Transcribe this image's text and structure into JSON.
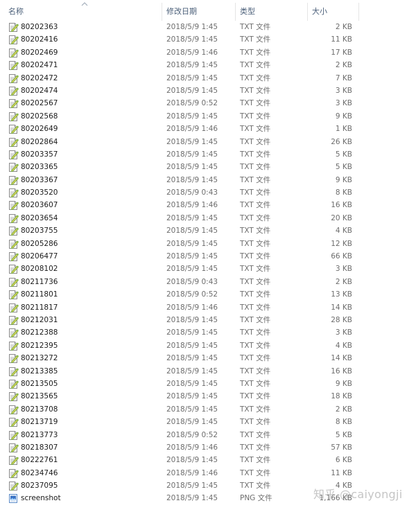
{
  "columns": {
    "name": "名称",
    "date": "修改日期",
    "type": "类型",
    "size": "大小"
  },
  "colors": {
    "header_text": "#4c607a",
    "meta_text": "#6d6d6d",
    "txt_icon_accent": "#7bb343"
  },
  "files": [
    {
      "name": "80202363",
      "date": "2018/5/9 1:45",
      "type": "TXT 文件",
      "size": "2 KB",
      "icon": "txt-file-icon"
    },
    {
      "name": "80202416",
      "date": "2018/5/9 1:45",
      "type": "TXT 文件",
      "size": "11 KB",
      "icon": "txt-file-icon"
    },
    {
      "name": "80202469",
      "date": "2018/5/9 1:46",
      "type": "TXT 文件",
      "size": "17 KB",
      "icon": "txt-file-icon"
    },
    {
      "name": "80202471",
      "date": "2018/5/9 1:45",
      "type": "TXT 文件",
      "size": "2 KB",
      "icon": "txt-file-icon"
    },
    {
      "name": "80202472",
      "date": "2018/5/9 1:45",
      "type": "TXT 文件",
      "size": "7 KB",
      "icon": "txt-file-icon"
    },
    {
      "name": "80202474",
      "date": "2018/5/9 1:45",
      "type": "TXT 文件",
      "size": "3 KB",
      "icon": "txt-file-icon"
    },
    {
      "name": "80202567",
      "date": "2018/5/9 0:52",
      "type": "TXT 文件",
      "size": "3 KB",
      "icon": "txt-file-icon"
    },
    {
      "name": "80202568",
      "date": "2018/5/9 1:45",
      "type": "TXT 文件",
      "size": "9 KB",
      "icon": "txt-file-icon"
    },
    {
      "name": "80202649",
      "date": "2018/5/9 1:46",
      "type": "TXT 文件",
      "size": "1 KB",
      "icon": "txt-file-icon"
    },
    {
      "name": "80202864",
      "date": "2018/5/9 1:45",
      "type": "TXT 文件",
      "size": "26 KB",
      "icon": "txt-file-icon"
    },
    {
      "name": "80203357",
      "date": "2018/5/9 1:45",
      "type": "TXT 文件",
      "size": "5 KB",
      "icon": "txt-file-icon"
    },
    {
      "name": "80203365",
      "date": "2018/5/9 1:45",
      "type": "TXT 文件",
      "size": "5 KB",
      "icon": "txt-file-icon"
    },
    {
      "name": "80203367",
      "date": "2018/5/9 1:45",
      "type": "TXT 文件",
      "size": "9 KB",
      "icon": "txt-file-icon"
    },
    {
      "name": "80203520",
      "date": "2018/5/9 0:43",
      "type": "TXT 文件",
      "size": "8 KB",
      "icon": "txt-file-icon"
    },
    {
      "name": "80203607",
      "date": "2018/5/9 1:46",
      "type": "TXT 文件",
      "size": "16 KB",
      "icon": "txt-file-icon"
    },
    {
      "name": "80203654",
      "date": "2018/5/9 1:45",
      "type": "TXT 文件",
      "size": "20 KB",
      "icon": "txt-file-icon"
    },
    {
      "name": "80203755",
      "date": "2018/5/9 1:45",
      "type": "TXT 文件",
      "size": "4 KB",
      "icon": "txt-file-icon"
    },
    {
      "name": "80205286",
      "date": "2018/5/9 1:45",
      "type": "TXT 文件",
      "size": "12 KB",
      "icon": "txt-file-icon"
    },
    {
      "name": "80206477",
      "date": "2018/5/9 1:45",
      "type": "TXT 文件",
      "size": "66 KB",
      "icon": "txt-file-icon"
    },
    {
      "name": "80208102",
      "date": "2018/5/9 1:45",
      "type": "TXT 文件",
      "size": "3 KB",
      "icon": "txt-file-icon"
    },
    {
      "name": "80211736",
      "date": "2018/5/9 0:43",
      "type": "TXT 文件",
      "size": "2 KB",
      "icon": "txt-file-icon"
    },
    {
      "name": "80211801",
      "date": "2018/5/9 0:52",
      "type": "TXT 文件",
      "size": "13 KB",
      "icon": "txt-file-icon"
    },
    {
      "name": "80211817",
      "date": "2018/5/9 1:46",
      "type": "TXT 文件",
      "size": "14 KB",
      "icon": "txt-file-icon"
    },
    {
      "name": "80212031",
      "date": "2018/5/9 1:45",
      "type": "TXT 文件",
      "size": "28 KB",
      "icon": "txt-file-icon"
    },
    {
      "name": "80212388",
      "date": "2018/5/9 1:45",
      "type": "TXT 文件",
      "size": "3 KB",
      "icon": "txt-file-icon"
    },
    {
      "name": "80212395",
      "date": "2018/5/9 1:45",
      "type": "TXT 文件",
      "size": "4 KB",
      "icon": "txt-file-icon"
    },
    {
      "name": "80213272",
      "date": "2018/5/9 1:45",
      "type": "TXT 文件",
      "size": "14 KB",
      "icon": "txt-file-icon"
    },
    {
      "name": "80213385",
      "date": "2018/5/9 1:45",
      "type": "TXT 文件",
      "size": "16 KB",
      "icon": "txt-file-icon"
    },
    {
      "name": "80213505",
      "date": "2018/5/9 1:45",
      "type": "TXT 文件",
      "size": "9 KB",
      "icon": "txt-file-icon"
    },
    {
      "name": "80213565",
      "date": "2018/5/9 1:45",
      "type": "TXT 文件",
      "size": "18 KB",
      "icon": "txt-file-icon"
    },
    {
      "name": "80213708",
      "date": "2018/5/9 1:45",
      "type": "TXT 文件",
      "size": "2 KB",
      "icon": "txt-file-icon"
    },
    {
      "name": "80213719",
      "date": "2018/5/9 1:45",
      "type": "TXT 文件",
      "size": "8 KB",
      "icon": "txt-file-icon"
    },
    {
      "name": "80213773",
      "date": "2018/5/9 0:52",
      "type": "TXT 文件",
      "size": "5 KB",
      "icon": "txt-file-icon"
    },
    {
      "name": "80218307",
      "date": "2018/5/9 1:46",
      "type": "TXT 文件",
      "size": "57 KB",
      "icon": "txt-file-icon"
    },
    {
      "name": "80222761",
      "date": "2018/5/9 1:45",
      "type": "TXT 文件",
      "size": "6 KB",
      "icon": "txt-file-icon"
    },
    {
      "name": "80234746",
      "date": "2018/5/9 1:46",
      "type": "TXT 文件",
      "size": "11 KB",
      "icon": "txt-file-icon"
    },
    {
      "name": "80237095",
      "date": "2018/5/9 1:45",
      "type": "TXT 文件",
      "size": "4 KB",
      "icon": "txt-file-icon"
    },
    {
      "name": "screenshot",
      "date": "2018/5/9 1:45",
      "type": "PNG 文件",
      "size": "1,166 KB",
      "icon": "png-file-icon"
    }
  ],
  "watermark": "知乎 @caiyongji"
}
